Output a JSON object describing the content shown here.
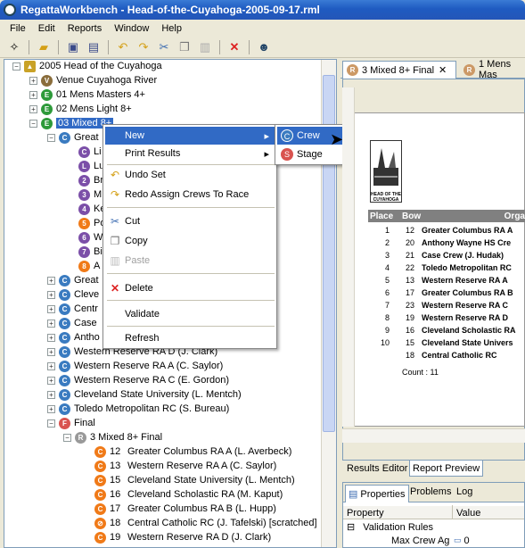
{
  "window": {
    "title": "RegattaWorkbench - Head-of-the-Cuyahoga-2005-09-17.rml"
  },
  "menu": [
    "File",
    "Edit",
    "Reports",
    "Window",
    "Help"
  ],
  "toolbar": {
    "icons": [
      "new-icon",
      "open-icon",
      "save-icon",
      "save-all-icon",
      "undo-icon",
      "redo-icon",
      "cut-icon",
      "copy-icon",
      "paste-icon",
      "delete-icon",
      "regatta-icon"
    ]
  },
  "tree": {
    "root": "2005 Head of the Cuyahoga",
    "venue": "Venue Cuyahoga River",
    "events": [
      "01 Mens Masters 4+",
      "02 Mens Light 8+",
      "03 Mixed 8+"
    ],
    "group": "Great",
    "sub_letters": [
      "Li",
      "Lu",
      "Br",
      "M",
      "Ke",
      "Po",
      "W",
      "Bi",
      "A"
    ],
    "crews_partial": [
      "Great",
      "Cleve",
      "Centr",
      "Case",
      "Antho"
    ],
    "crews": [
      "Western Reserve RA D  (J. Clark)",
      "Western Reserve RA A  (C. Saylor)",
      "Western Reserve RA C  (E. Gordon)",
      "Cleveland State University  (L. Mentch)",
      "Toledo Metropolitan RC  (S. Bureau)"
    ],
    "final": "Final",
    "race": "3  Mixed 8+ Final",
    "race_crews": [
      {
        "bow": "12",
        "name": "Greater Columbus RA A  (L. Averbeck)"
      },
      {
        "bow": "13",
        "name": "Western Reserve RA A  (C. Saylor)"
      },
      {
        "bow": "15",
        "name": "Cleveland State University  (L. Mentch)"
      },
      {
        "bow": "16",
        "name": "Cleveland Scholastic RA  (M. Kaput)"
      },
      {
        "bow": "17",
        "name": "Greater Columbus RA B  (L. Hupp)"
      },
      {
        "bow": "18",
        "name": "Central Catholic RC  (J. Tafelski) [scratched]"
      },
      {
        "bow": "19",
        "name": "Western Reserve RA D  (J. Clark)"
      }
    ]
  },
  "context_menu": {
    "new": "New",
    "print": "Print Results",
    "undo": "Undo Set",
    "redo": "Redo Assign Crews To Race",
    "cut": "Cut",
    "copy": "Copy",
    "paste": "Paste",
    "delete": "Delete",
    "validate": "Validate",
    "refresh": "Refresh"
  },
  "submenu": {
    "crew": "Crew",
    "stage": "Stage"
  },
  "editor_tabs": [
    "3  Mixed 8+ Final",
    "1  Mens Mas"
  ],
  "report": {
    "logo_text": "HEAD OF THE CUYAHOGA",
    "headers": {
      "place": "Place",
      "bow": "Bow",
      "org": "Orga"
    },
    "rows": [
      {
        "place": "1",
        "bow": "12",
        "org": "Greater Columbus RA A"
      },
      {
        "place": "2",
        "bow": "20",
        "org": "Anthony Wayne HS Cre"
      },
      {
        "place": "3",
        "bow": "21",
        "org": "Case Crew (J. Hudak)"
      },
      {
        "place": "4",
        "bow": "22",
        "org": "Toledo Metropolitan RC"
      },
      {
        "place": "5",
        "bow": "13",
        "org": "Western Reserve RA A"
      },
      {
        "place": "6",
        "bow": "17",
        "org": "Greater Columbus RA B"
      },
      {
        "place": "7",
        "bow": "23",
        "org": "Western Reserve RA C"
      },
      {
        "place": "8",
        "bow": "19",
        "org": "Western Reserve RA D"
      },
      {
        "place": "9",
        "bow": "16",
        "org": "Cleveland Scholastic RA"
      },
      {
        "place": "10",
        "bow": "15",
        "org": "Cleveland State Univers"
      },
      {
        "place": "",
        "bow": "18",
        "org": "Central Catholic RC"
      }
    ],
    "count": "Count :  11"
  },
  "view_tabs": {
    "editor": "Results Editor",
    "preview": "Report Preview"
  },
  "panel_tabs": {
    "properties": "Properties",
    "problems": "Problems",
    "log": "Log"
  },
  "props": {
    "col_property": "Property",
    "col_value": "Value",
    "group": "Validation Rules",
    "item": "Max Crew Ag",
    "item_value": "0"
  }
}
